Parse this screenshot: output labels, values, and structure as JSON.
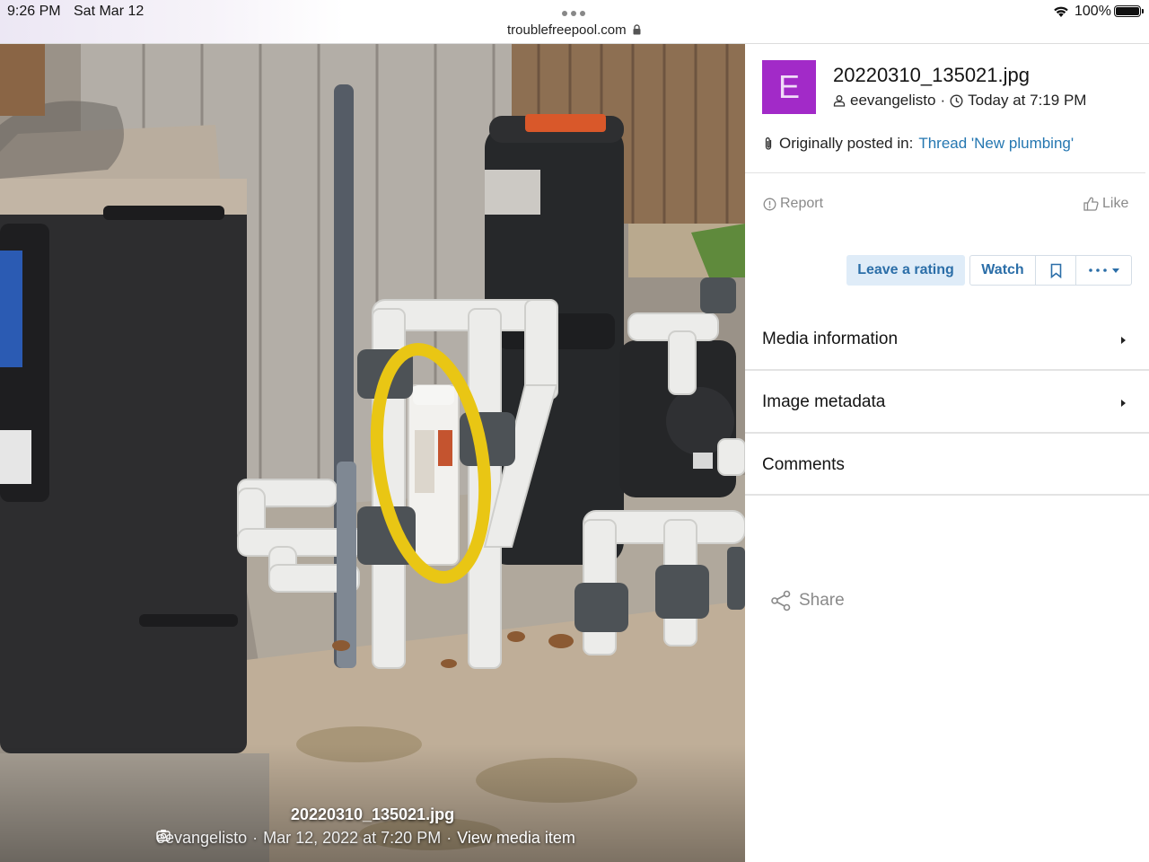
{
  "status_bar": {
    "time": "9:26 PM",
    "date": "Sat Mar 12",
    "url": "troublefreepool.com",
    "battery": "100%"
  },
  "photo": {
    "caption_title": "20220310_135021.jpg",
    "caption_user": "eevangelisto",
    "caption_date": "Mar 12, 2022 at 7:20 PM",
    "view_media_label": "View media item"
  },
  "panel": {
    "avatar_letter": "E",
    "avatar_color": "#a22ac8",
    "filename": "20220310_135021.jpg",
    "author": "eevangelisto",
    "posted_time": "Today at 7:19 PM",
    "originally_posted_label": "Originally posted in:",
    "thread_link": "Thread 'New plumbing'",
    "report_label": "Report",
    "like_label": "Like",
    "leave_rating_label": "Leave a rating",
    "watch_label": "Watch",
    "sections": [
      "Media information",
      "Image metadata",
      "Comments"
    ],
    "share_label": "Share",
    "link_color": "#2577b1"
  }
}
